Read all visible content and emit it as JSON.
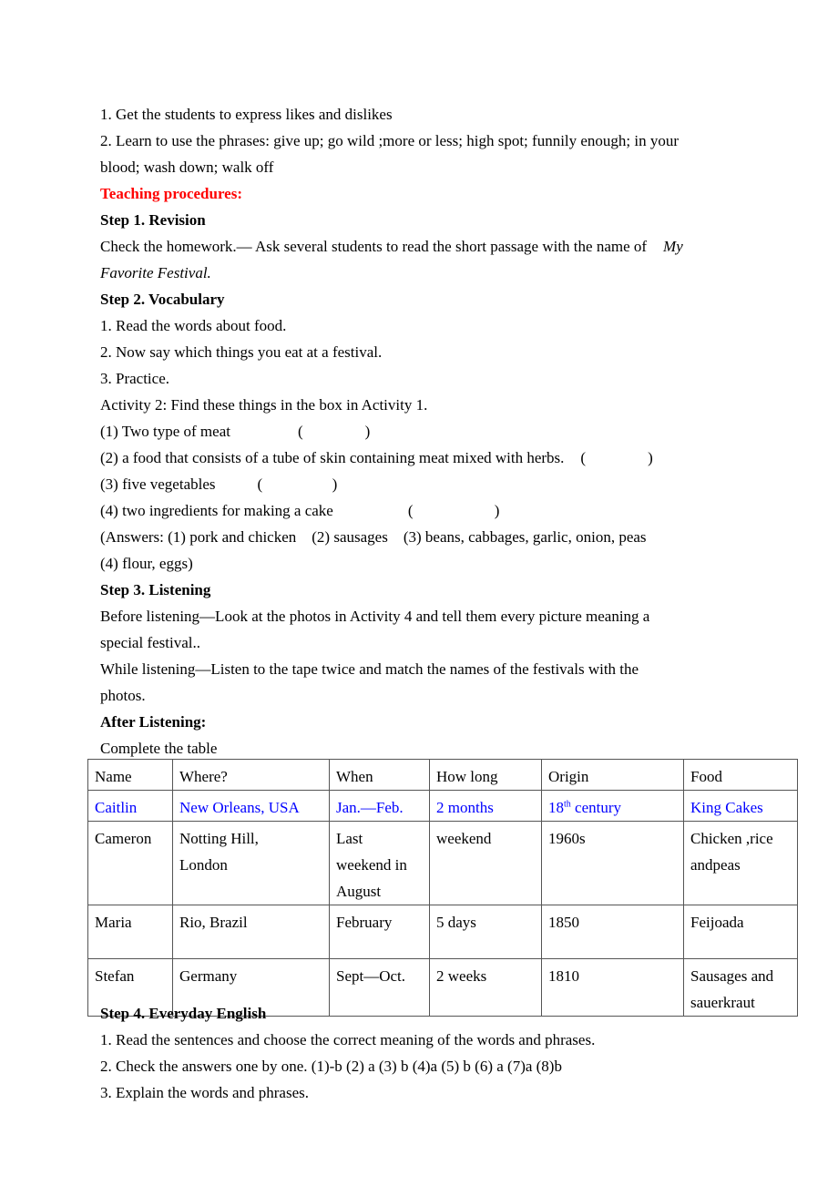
{
  "objectives": [
    "1. Get the students to express likes and dislikes",
    "2. Learn to use the phrases: give up; go wild ;more or less; high spot; funnily enough; in your",
    "blood; wash down; walk off"
  ],
  "teaching_procedures_heading": "Teaching procedures:",
  "step1": {
    "heading": "Step 1. Revision",
    "text_line1": "Check the homework.— Ask several students to read the short passage with the name of",
    "title_part1": "My",
    "title_part2": "Favorite Festival."
  },
  "step2": {
    "heading": "Step 2. Vocabulary",
    "items": [
      "1. Read the words about food.",
      "2. Now say which things you eat at a festival.",
      "3. Practice."
    ],
    "activity": "Activity 2: Find these things in the box in Activity 1.",
    "questions": [
      {
        "text": "(1) Two type of meat",
        "blank": "(                )"
      },
      {
        "text": "(2) a food that consists of a tube of skin containing meat mixed with herbs.",
        "blank": "(                )"
      },
      {
        "text": "(3) five vegetables",
        "blank": "(                  )"
      },
      {
        "text": "(4) two ingredients for making a cake",
        "blank": "(                     )"
      }
    ],
    "answers_line1": "(Answers: (1) pork and chicken    (2) sausages    (3) beans, cabbages, garlic, onion, peas",
    "answers_line2": "(4) flour, eggs)"
  },
  "step3": {
    "heading": "Step 3. Listening",
    "before_line1": "Before listening—Look at the photos in Activity 4 and tell them every picture meaning a",
    "before_line2": "special festival..",
    "while_line1": "While listening—Listen to the tape twice and match the names of the festivals with the",
    "while_line2": "photos.",
    "after_heading": "After Listening:",
    "complete": "Complete the table"
  },
  "table": {
    "headers": [
      "Name",
      "Where?",
      "When",
      "How long",
      "Origin",
      "Food"
    ],
    "example_row": {
      "name": "Caitlin",
      "where": "New Orleans, USA",
      "when": "Jan.—Feb.",
      "how_long": "2 months",
      "origin_num": "18",
      "origin_sup": "th",
      "origin_rest": " century",
      "food": "King Cakes",
      "color": "#0000ff"
    },
    "rows": [
      {
        "name": "Cameron",
        "where_1": "Notting Hill,",
        "where_2": "London",
        "when_1": "Last",
        "when_2": "weekend in",
        "when_3": "August",
        "how_long": "weekend",
        "origin": "1960s",
        "food_1": "Chicken ,rice",
        "food_2": "andpeas"
      },
      {
        "name": "Maria",
        "where": "Rio, Brazil",
        "when": "February",
        "how_long": "5 days",
        "origin": "1850",
        "food": "Feijoada"
      },
      {
        "name": "Stefan",
        "where": "Germany",
        "when": "Sept—Oct.",
        "how_long": "2 weeks",
        "origin": "1810",
        "food_1": "Sausages and",
        "food_2": "sauerkraut"
      }
    ]
  },
  "step4": {
    "heading": "Step 4. Everyday English",
    "items": [
      "1. Read the sentences and choose the correct meaning of the words and phrases.",
      "2. Check the answers one by one. (1)-b (2) a (3) b (4)a (5) b (6) a (7)a (8)b",
      "3. Explain the words and phrases."
    ]
  },
  "colors": {
    "heading_red": "#ff0000",
    "example_blue": "#0000ff"
  }
}
